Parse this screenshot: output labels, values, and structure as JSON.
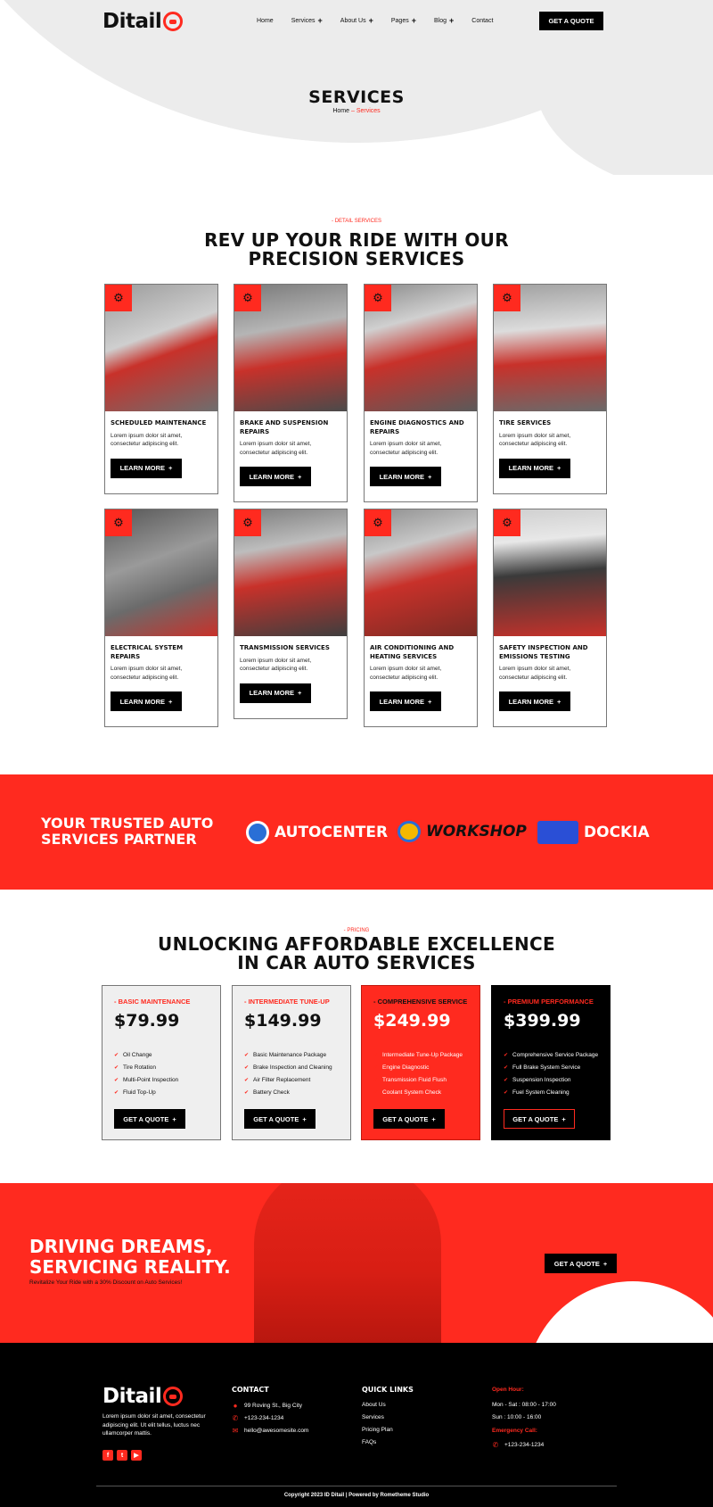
{
  "brand": {
    "logo_text": "Ditail"
  },
  "nav": {
    "items": [
      {
        "label": "Home",
        "has_plus": false
      },
      {
        "label": "Services",
        "has_plus": true
      },
      {
        "label": "About Us",
        "has_plus": true
      },
      {
        "label": "Pages",
        "has_plus": true
      },
      {
        "label": "Blog",
        "has_plus": true
      },
      {
        "label": "Contact",
        "has_plus": false
      }
    ],
    "quote_button": "GET A QUOTE"
  },
  "hero": {
    "title": "SERVICES",
    "breadcrumb_home": "Home",
    "breadcrumb_sep": "–",
    "breadcrumb_current": "Services"
  },
  "services": {
    "eyebrow": "- DETAIL SERVICES",
    "title_line1": "REV UP YOUR RIDE WITH OUR",
    "title_line2": "PRECISION SERVICES",
    "learn_more": "LEARN MORE",
    "cards": [
      {
        "title": "SCHEDULED MAINTENANCE",
        "desc": "Lorem ipsum dolor sit amet, consectetur adipiscing elit."
      },
      {
        "title": "BRAKE AND SUSPENSION REPAIRS",
        "desc": "Lorem ipsum dolor sit amet, consectetur adipiscing elit."
      },
      {
        "title": "ENGINE DIAGNOSTICS AND REPAIRS",
        "desc": "Lorem ipsum dolor sit amet, consectetur adipiscing elit."
      },
      {
        "title": "TIRE SERVICES",
        "desc": "Lorem ipsum dolor sit amet, consectetur adipiscing elit."
      },
      {
        "title": "ELECTRICAL SYSTEM REPAIRS",
        "desc": "Lorem ipsum dolor sit amet, consectetur adipiscing elit."
      },
      {
        "title": "TRANSMISSION SERVICES",
        "desc": "Lorem ipsum dolor sit amet, consectetur adipiscing elit."
      },
      {
        "title": "AIR CONDITIONING AND HEATING SERVICES",
        "desc": "Lorem ipsum dolor sit amet, consectetur adipiscing elit."
      },
      {
        "title": "SAFETY INSPECTION AND EMISSIONS TESTING",
        "desc": "Lorem ipsum dolor sit amet, consectetur adipiscing elit."
      }
    ]
  },
  "partners": {
    "title_line1": "YOUR TRUSTED AUTO",
    "title_line2": "SERVICES PARTNER",
    "brands": [
      "AUTOCENTER",
      "WORKSHOP",
      "DOCKIA"
    ]
  },
  "pricing": {
    "eyebrow": "- PRICING",
    "title_line1": "UNLOCKING AFFORDABLE EXCELLENCE",
    "title_line2": "IN CAR AUTO SERVICES",
    "button": "GET A QUOTE",
    "plans": [
      {
        "tag": "- BASIC MAINTENANCE",
        "price": "$79.99",
        "features": [
          "Oil Change",
          "Tire Rotation",
          "Multi-Point Inspection",
          "Fluid Top-Up"
        ]
      },
      {
        "tag": "- INTERMEDIATE TUNE-UP",
        "price": "$149.99",
        "features": [
          "Basic Maintenance Package",
          "Brake Inspection and Cleaning",
          "Air Filter Replacement",
          "Battery Check"
        ]
      },
      {
        "tag": "- COMPREHENSIVE SERVICE",
        "price": "$249.99",
        "features": [
          "Intermediate Tune-Up Package",
          "Engine Diagnostic",
          "Transmission Fluid Flush",
          "Coolant System Check"
        ]
      },
      {
        "tag": "- PREMIUM PERFORMANCE",
        "price": "$399.99",
        "features": [
          "Comprehensive Service Package",
          "Full Brake System Service",
          "Suspension Inspection",
          "Fuel System Cleaning"
        ]
      }
    ]
  },
  "cta": {
    "title_line1": "DRIVING DREAMS,",
    "title_line2": "SERVICING REALITY.",
    "subtitle": "Revitalize Your Ride with a 30% Discount on Auto Services!",
    "button": "GET A QUOTE"
  },
  "footer": {
    "about": "Lorem ipsum dolor sit amet, consectetur adipiscing elit. Ut elit tellus, luctus nec ullamcorper mattis.",
    "contact_heading": "CONTACT",
    "address": "99 Roving St., Big City",
    "phone": "+123-234-1234",
    "email": "hello@awesomesite.com",
    "links_heading": "QUICK LINKS",
    "links": [
      "About Us",
      "Services",
      "Pricing Plan",
      "FAQs"
    ],
    "open_label": "Open Hour:",
    "hours_weekday": "Mon - Sat : 08:00 - 17:00",
    "hours_sunday": "Sun : 10:00 - 16:00",
    "emergency_label": "Emergency Call:",
    "emergency_phone": "+123-234-1234",
    "copyright": "Copyright 2023 ID Ditail | Powered by Rometheme Studio"
  },
  "colors": {
    "accent": "#ff2a1f",
    "dark": "#000000",
    "light": "#ececec"
  }
}
